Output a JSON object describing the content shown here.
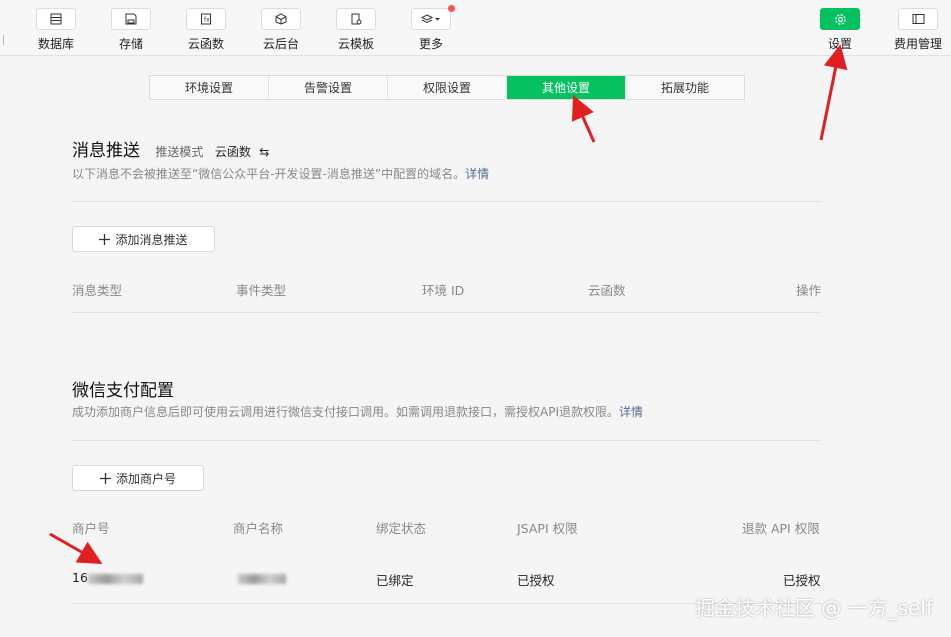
{
  "toolbar": {
    "items": [
      {
        "label": "数据库",
        "icon": "database-icon"
      },
      {
        "label": "存储",
        "icon": "storage-icon"
      },
      {
        "label": "云函数",
        "icon": "cloud-function-icon"
      },
      {
        "label": "云后台",
        "icon": "cloud-backend-icon"
      },
      {
        "label": "云模板",
        "icon": "cloud-template-icon"
      },
      {
        "label": "更多",
        "icon": "layers-icon"
      }
    ],
    "settings_label": "设置",
    "billing_label": "费用管理"
  },
  "tabs": [
    "环境设置",
    "告警设置",
    "权限设置",
    "其他设置",
    "拓展功能"
  ],
  "active_tab": "其他设置",
  "push": {
    "title": "消息推送",
    "mode_label": "推送模式",
    "mode_value": "云函数",
    "mode_icon": "⇆",
    "desc": "以下消息不会被推送至“微信公众平台-开发设置-消息推送”中配置的域名。",
    "desc_link": "详情",
    "add_button": "添加消息推送",
    "columns": [
      "消息类型",
      "事件类型",
      "环境 ID",
      "云函数",
      "操作"
    ]
  },
  "pay": {
    "title": "微信支付配置",
    "desc": "成功添加商户信息后即可使用云调用进行微信支付接口调用。如需调用退款接口，需授权API退款权限。",
    "desc_link": "详情",
    "add_button": "添加商户号",
    "columns": [
      "商户号",
      "商户名称",
      "绑定状态",
      "JSAPI 权限",
      "退款 API 权限"
    ],
    "row": {
      "merchant_id_prefix": "16",
      "bind_status": "已绑定",
      "jsapi": "已授权",
      "refund": "已授权"
    }
  },
  "watermark": "掘金技术社区 @ 一方_self",
  "colors": {
    "accent": "#07c160",
    "link": "#576b95",
    "annotation": "#e02020"
  }
}
